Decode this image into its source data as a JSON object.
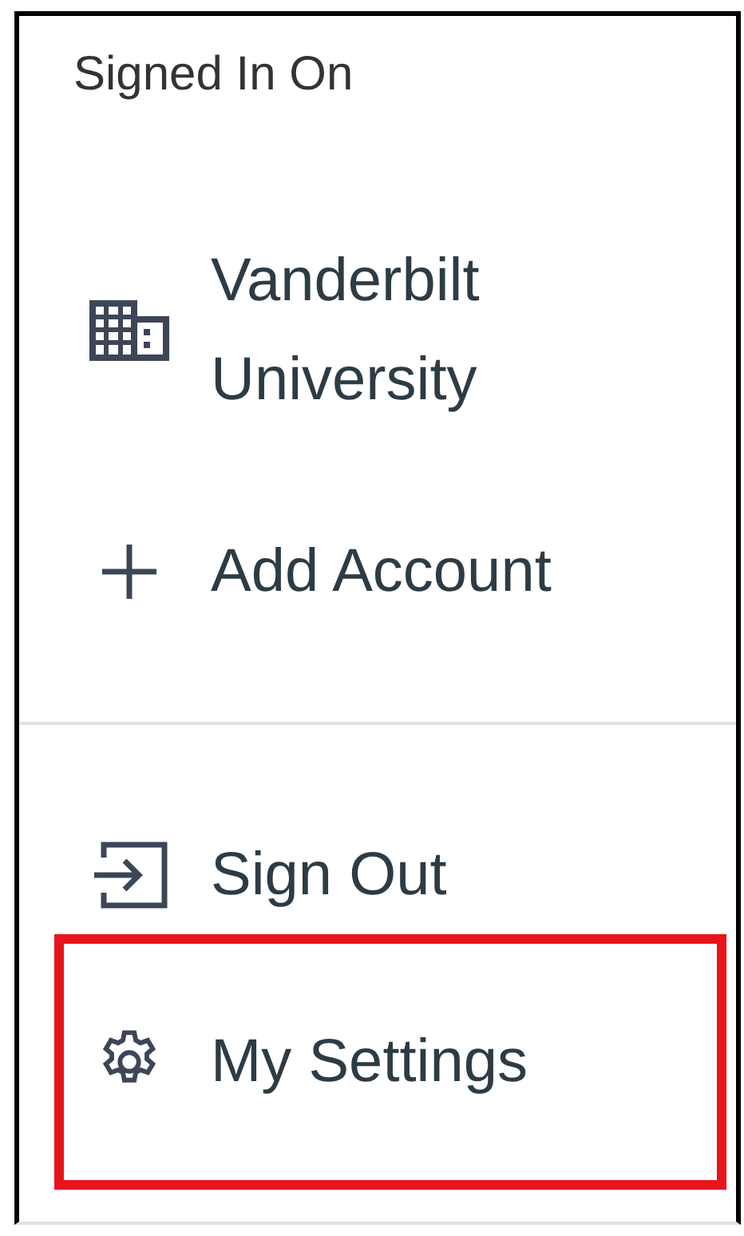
{
  "menu": {
    "heading": "Signed In On",
    "accounts": [
      {
        "kind": "institution",
        "label": "Vanderbilt University"
      },
      {
        "kind": "add",
        "label": "Add Account"
      }
    ],
    "actions": [
      {
        "kind": "sign-out",
        "label": "Sign Out",
        "highlighted": false
      },
      {
        "kind": "settings",
        "label": "My Settings",
        "highlighted": true
      }
    ]
  }
}
